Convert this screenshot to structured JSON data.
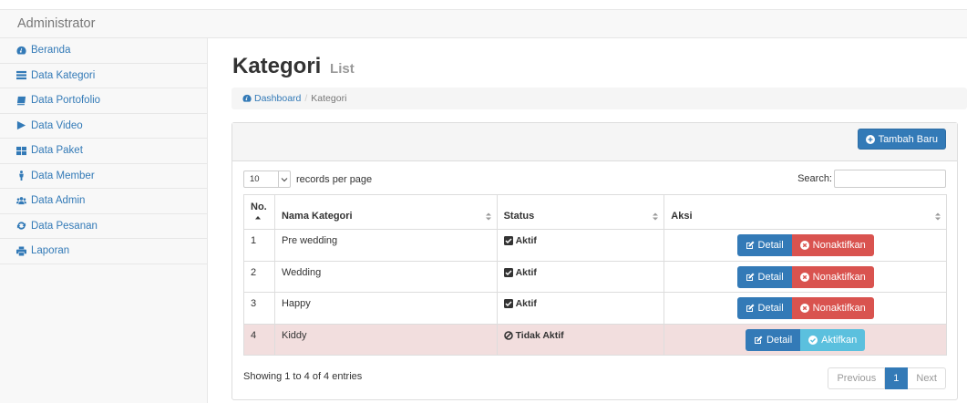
{
  "app": {
    "brand": "Administrator"
  },
  "sidebar": {
    "items": [
      {
        "label": "Beranda",
        "icon": "dashboard-icon"
      },
      {
        "label": "Data Kategori",
        "icon": "list-icon"
      },
      {
        "label": "Data Portofolio",
        "icon": "book-icon"
      },
      {
        "label": "Data Video",
        "icon": "play-icon"
      },
      {
        "label": "Data Paket",
        "icon": "th-icon"
      },
      {
        "label": "Data Member",
        "icon": "male-icon"
      },
      {
        "label": "Data Admin",
        "icon": "users-icon"
      },
      {
        "label": "Data Pesanan",
        "icon": "refresh-icon"
      },
      {
        "label": "Laporan",
        "icon": "print-icon"
      }
    ]
  },
  "header": {
    "title": "Kategori",
    "subtitle": "List"
  },
  "breadcrumb": {
    "home": "Dashboard",
    "separator": "/",
    "current": "Kategori"
  },
  "toolbar": {
    "add_label": "Tambah Baru"
  },
  "datatable": {
    "length_value": "10",
    "length_label": "records per page",
    "search_label": "Search:",
    "search_value": "",
    "columns": [
      "No.",
      "Nama Kategori",
      "Status",
      "Aksi"
    ],
    "rows": [
      {
        "no": "1",
        "name": "Pre wedding",
        "status": "Aktif",
        "detail": "Detail",
        "toggle": "Nonaktifkan"
      },
      {
        "no": "2",
        "name": "Wedding",
        "status": "Aktif",
        "detail": "Detail",
        "toggle": "Nonaktifkan"
      },
      {
        "no": "3",
        "name": "Happy",
        "status": "Aktif",
        "detail": "Detail",
        "toggle": "Nonaktifkan"
      },
      {
        "no": "4",
        "name": "Kiddy",
        "status": "Tidak Aktif",
        "detail": "Detail",
        "toggle": "Aktifkan"
      }
    ],
    "info": "Showing 1 to 4 of 4 entries",
    "pagination": {
      "previous": "Previous",
      "current": "1",
      "next": "Next"
    }
  },
  "colors": {
    "primary": "#337ab7",
    "danger": "#d9534f",
    "info": "#5bc0de",
    "inactive_row": "#f2dede"
  }
}
